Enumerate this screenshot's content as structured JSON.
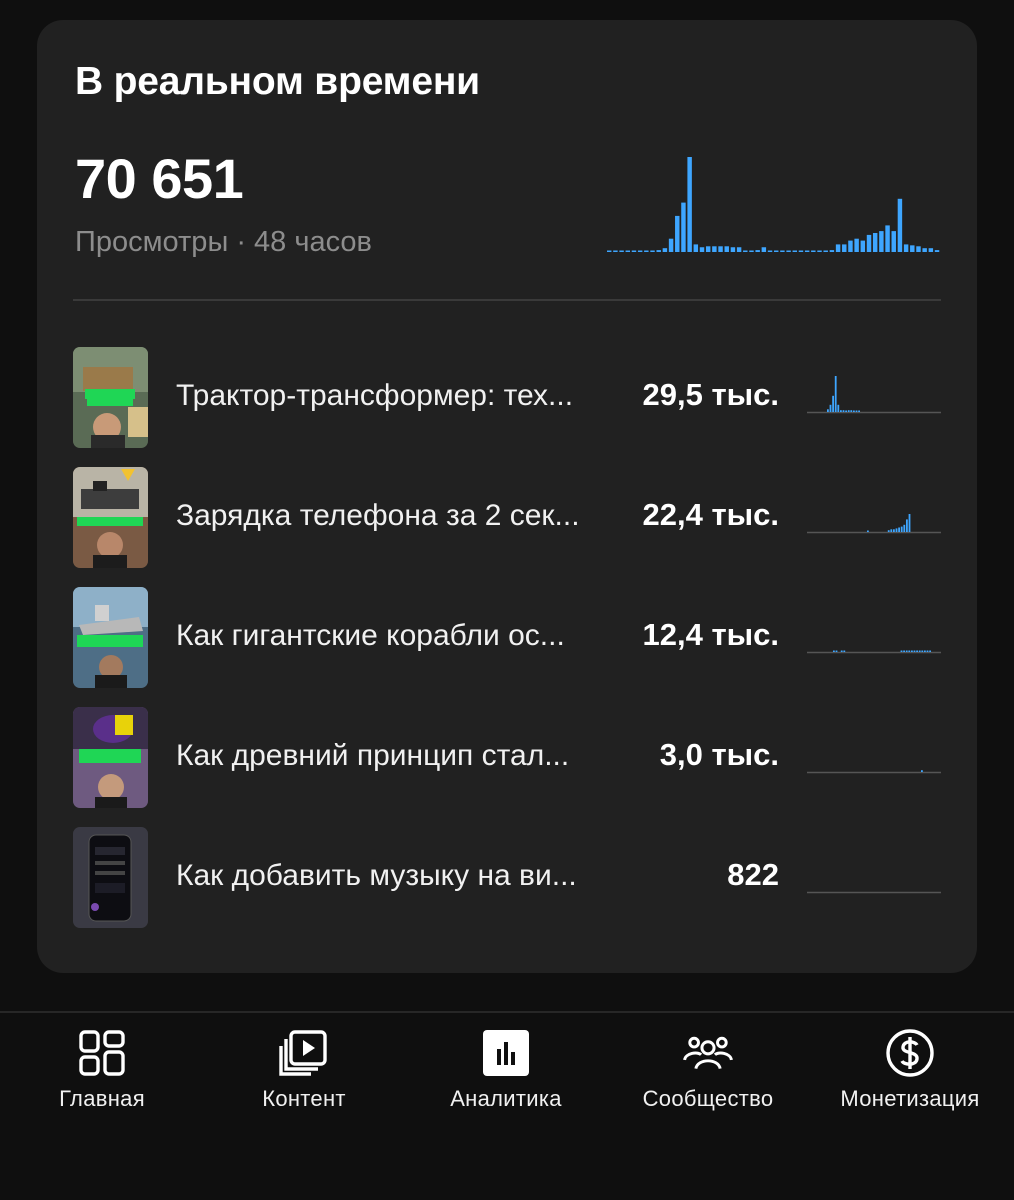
{
  "realtime": {
    "title": "В реальном времени",
    "views_total": "70 651",
    "views_caption": "Просмотры · 48 часов",
    "accent_color": "#3ea6ff"
  },
  "chart_data": {
    "type": "bar",
    "values": [
      1,
      1,
      1,
      1,
      1,
      1,
      1,
      1,
      2,
      4,
      14,
      38,
      52,
      100,
      8,
      5,
      6,
      6,
      6,
      6,
      5,
      5,
      1,
      1,
      2,
      5,
      1,
      1,
      1,
      1,
      1,
      1,
      1,
      1,
      1,
      1,
      2,
      8,
      8,
      12,
      14,
      12,
      18,
      20,
      22,
      28,
      22,
      56,
      8,
      7,
      6,
      4,
      4,
      2
    ]
  },
  "videos": [
    {
      "title": "Трактор-трансформер: тех...",
      "views": "29,5 тыс.",
      "spark": [
        3,
        8,
        18,
        40,
        8,
        2,
        2,
        1,
        2,
        2,
        1,
        1,
        1
      ],
      "spark_start": 20
    },
    {
      "title": "Зарядка телефона за 2 сек...",
      "views": "22,4 тыс.",
      "spark": [
        1,
        0,
        0,
        0,
        0,
        0,
        0,
        0,
        2,
        3,
        3,
        4,
        5,
        6,
        8,
        14,
        20
      ],
      "spark_start": 60
    },
    {
      "title": "Как гигантские корабли ос...",
      "views": "12,4 тыс.",
      "spark": [
        1,
        1,
        0,
        1,
        1,
        0,
        0,
        0,
        0,
        0,
        0,
        0,
        0,
        0,
        0,
        0,
        0,
        0,
        0,
        0,
        0,
        0,
        0,
        0,
        0,
        0,
        1,
        1,
        1,
        1,
        1,
        1,
        1,
        1,
        1,
        1,
        1,
        1
      ],
      "spark_start": 26
    },
    {
      "title": "Как древний принцип стал...",
      "views": "3,0 тыс.",
      "spark": [
        2
      ],
      "spark_start": 114
    },
    {
      "title": "Как добавить музыку на ви...",
      "views": "822",
      "spark": [],
      "spark_start": 0
    }
  ],
  "nav": [
    {
      "label": "Главная",
      "icon": "home-grid-icon"
    },
    {
      "label": "Контент",
      "icon": "content-library-icon"
    },
    {
      "label": "Аналитика",
      "icon": "analytics-icon",
      "active": true
    },
    {
      "label": "Сообщество",
      "icon": "community-icon"
    },
    {
      "label": "Монетизация",
      "icon": "monetization-dollar-icon"
    }
  ]
}
